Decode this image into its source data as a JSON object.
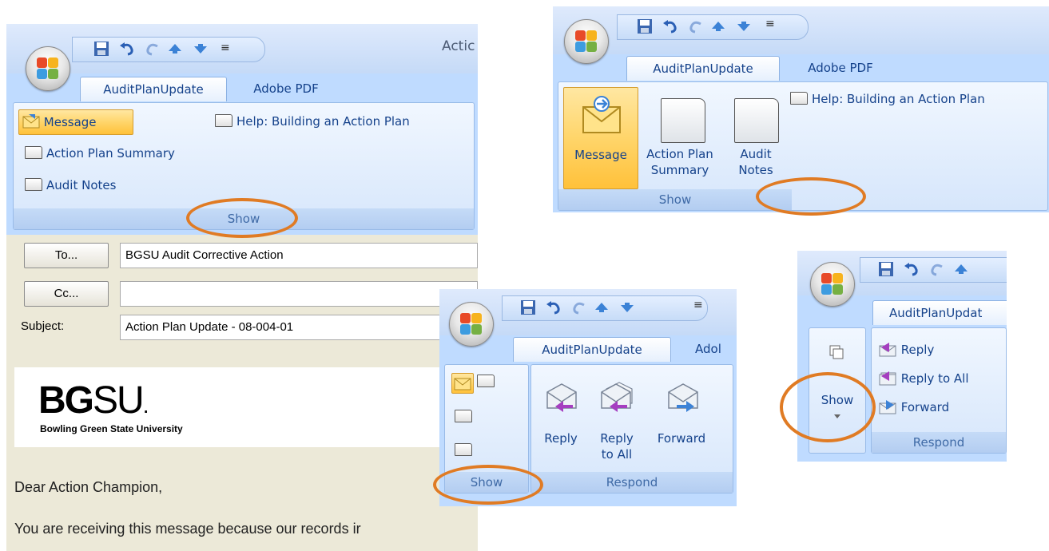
{
  "qat": {
    "save_icon": "save-icon",
    "undo_icon": "undo-icon",
    "redo_icon": "redo-icon",
    "up_icon": "up-arrow-icon",
    "down_icon": "down-arrow-icon",
    "customize_icon": "customize-dropdown-icon"
  },
  "tabs": {
    "audit": "AuditPlanUpdate",
    "adobe": "Adobe PDF",
    "audit_cut": "AuditPlanUpdat",
    "adobe_cut": "Adol"
  },
  "window_title_cut": "Actic",
  "show_group": {
    "label": "Show",
    "message": "Message",
    "action_plan_summary": "Action Plan Summary",
    "action_plan_line1": "Action Plan",
    "action_plan_line2": "Summary",
    "audit_notes": "Audit Notes",
    "audit_line1": "Audit",
    "audit_line2": "Notes",
    "help": "Help: Building an Action Plan"
  },
  "respond_group": {
    "label": "Respond",
    "reply": "Reply",
    "reply_all": "Reply to All",
    "reply_line1": "Reply",
    "reply_line2": "to All",
    "forward": "Forward"
  },
  "message_form": {
    "to_label": "To...",
    "cc_label": "Cc...",
    "subject_label": "Subject:",
    "to_value": "BGSU Audit Corrective Action",
    "cc_value": "",
    "subject_value": "Action Plan Update - 08-004-01"
  },
  "body": {
    "logo_text": "BGSU.",
    "logo_bold": "BG",
    "logo_light": "SU",
    "logo_dot": ".",
    "university": "Bowling Green State University",
    "greeting": "Dear Action Champion,",
    "line1": "You are receiving this message because our records ir"
  },
  "colors": {
    "highlight_ring": "#e07b24",
    "ribbon_blue": "#bfdbff",
    "label_blue": "#15428b"
  }
}
